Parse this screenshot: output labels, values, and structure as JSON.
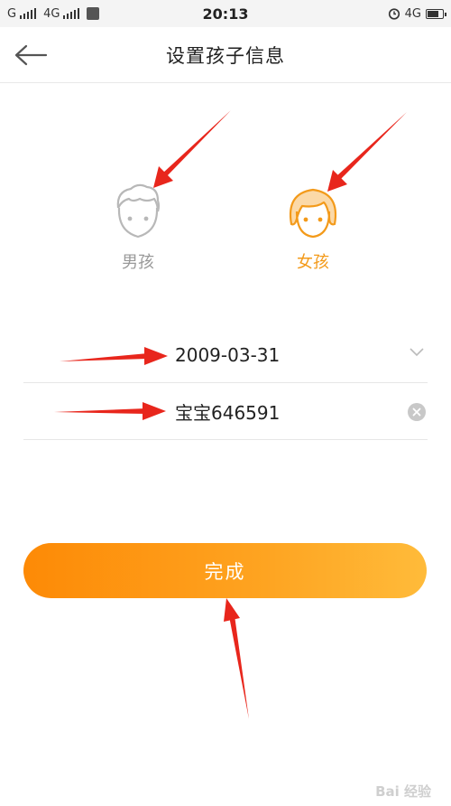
{
  "status_bar": {
    "signal1": "G",
    "signal2": "4G",
    "time": "20:13",
    "network": "4G"
  },
  "header": {
    "title": "设置孩子信息"
  },
  "gender": {
    "boy_label": "男孩",
    "girl_label": "女孩",
    "selected": "girl"
  },
  "form": {
    "birthday": "2009-03-31",
    "nickname": "宝宝646591"
  },
  "actions": {
    "done_label": "完成"
  },
  "watermark": "Bai 经验",
  "colors": {
    "accent": "#f39a1a",
    "button_start": "#fd8a06",
    "button_end": "#ffbb3a",
    "annotation": "#e8261c"
  }
}
